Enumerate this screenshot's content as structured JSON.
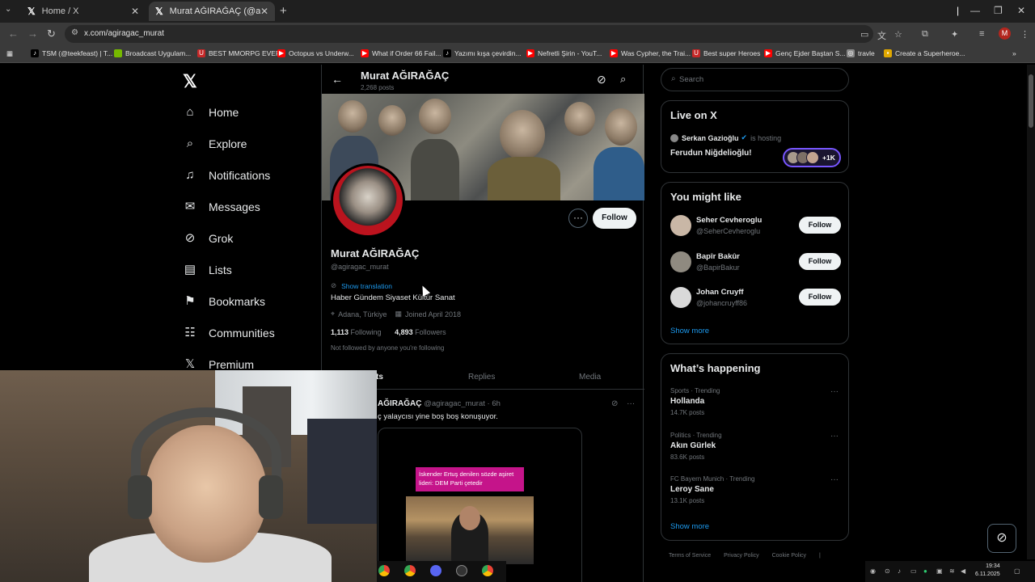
{
  "browser": {
    "tabs": [
      {
        "title": "Home / X"
      },
      {
        "title": "Murat AĞIRAĞAÇ (@agiragac_m"
      }
    ],
    "url": "x.com/agiragac_murat",
    "profile_initial": "M",
    "bookmarks": [
      {
        "label": "TSM (@teekfeast) | T...",
        "icon": "tiktok-icon",
        "color": "#000000"
      },
      {
        "label": "Broadcast Uygulam...",
        "icon": "nvidia-icon",
        "color": "#76b900"
      },
      {
        "label": "BEST MMORPG EVER",
        "icon": "u-icon",
        "color": "#c62828"
      },
      {
        "label": "Octopus vs Underw...",
        "icon": "youtube-icon",
        "color": "#ff0000"
      },
      {
        "label": "What if Order 66 Fail...",
        "icon": "youtube-icon",
        "color": "#ff0000"
      },
      {
        "label": "Yazımı kışa çevirdin...",
        "icon": "tiktok-icon",
        "color": "#000000"
      },
      {
        "label": "Nefretli Şirin - YouT...",
        "icon": "youtube-icon",
        "color": "#ff0000"
      },
      {
        "label": "Was Cypher, the Trai...",
        "icon": "youtube-icon",
        "color": "#ff0000"
      },
      {
        "label": "Best super Heroes",
        "icon": "u-icon",
        "color": "#c62828"
      },
      {
        "label": "Genç Ejder Baştan S...",
        "icon": "youtube-icon",
        "color": "#ff0000"
      },
      {
        "label": "travle",
        "icon": "globe-icon",
        "color": "#888888"
      },
      {
        "label": "Create a Superheroe...",
        "icon": "page-icon",
        "color": "#e0a800"
      }
    ]
  },
  "nav": {
    "items": [
      {
        "label": "Home",
        "icon": "home-icon",
        "glyph": "⌂"
      },
      {
        "label": "Explore",
        "icon": "search-icon",
        "glyph": "⌕"
      },
      {
        "label": "Notifications",
        "icon": "bell-icon",
        "glyph": "🔔︎"
      },
      {
        "label": "Messages",
        "icon": "mail-icon",
        "glyph": "✉"
      },
      {
        "label": "Grok",
        "icon": "grok-icon",
        "glyph": "⊘"
      },
      {
        "label": "Lists",
        "icon": "list-icon",
        "glyph": "▤"
      },
      {
        "label": "Bookmarks",
        "icon": "bookmark-icon",
        "glyph": "⚑"
      },
      {
        "label": "Communities",
        "icon": "communities-icon",
        "glyph": "👥︎"
      },
      {
        "label": "Premium",
        "icon": "x-logo-icon",
        "glyph": "𝕏"
      }
    ]
  },
  "profile": {
    "header_name": "Murat AĞIRAĞAÇ",
    "header_posts": "2,268 posts",
    "name": "Murat AĞIRAĞAÇ",
    "handle": "@agiragac_murat",
    "show_translation": "Show translation",
    "bio": "Haber Gündem Siyaset Kültür Sanat",
    "location": "Adana, Türkiye",
    "joined": "Joined April 2018",
    "following_count": "1,113",
    "following_label": "Following",
    "followers_count": "4,893",
    "followers_label": "Followers",
    "not_followed": "Not followed by anyone you're following",
    "follow_label": "Follow",
    "more_glyph": "···"
  },
  "profile_tabs": {
    "posts": "ts",
    "replies": "Replies",
    "media": "Media"
  },
  "post": {
    "author": "AĞIRAĞAÇ",
    "handle_time": "@agiragac_murat · 6h",
    "text": "ç yalaycısı yine boş boş konuşuyor.",
    "media_caption": "İskender Ertuş denilen sözde aşiret lideri: DEM Parti çetedir"
  },
  "right": {
    "search_placeholder": "Search",
    "live": {
      "title": "Live on X",
      "host": "Serkan Gazioğlu",
      "hosting_label": "is hosting",
      "space_title": "Ferudun Niğdelioğlu!",
      "listeners": "+1K"
    },
    "might_like": {
      "title": "You might like",
      "users": [
        {
          "name": "Seher Cevheroglu",
          "handle": "@SeherCevheroglu",
          "follow": "Follow",
          "avatar_color": "#c9b7a6"
        },
        {
          "name": "Bapîr Bakûr",
          "handle": "@BapirBakur",
          "follow": "Follow",
          "avatar_color": "#8f8a80"
        },
        {
          "name": "Johan Cruyff",
          "handle": "@johancruyff86",
          "follow": "Follow",
          "avatar_color": "#d9d9d9"
        }
      ],
      "show_more": "Show more"
    },
    "happening": {
      "title": "What’s happening",
      "trends": [
        {
          "category": "Sports · Trending",
          "name": "Hollanda",
          "posts": "14.7K posts"
        },
        {
          "category": "Politics · Trending",
          "name": "Akın Gürlek",
          "posts": "83.6K posts"
        },
        {
          "category": "FC Bayern Munich · Trending",
          "name": "Leroy Sane",
          "posts": "13.1K posts"
        }
      ],
      "show_more": "Show more"
    },
    "footer": [
      "Terms of Service",
      "Privacy Policy",
      "Cookie Policy",
      "|"
    ]
  },
  "taskbar": {
    "time": "19:34",
    "date": "6.11.2025"
  },
  "colors": {
    "accent": "#1d9bf0",
    "background": "#000000",
    "border": "#2f3336",
    "muted": "#71767b"
  }
}
